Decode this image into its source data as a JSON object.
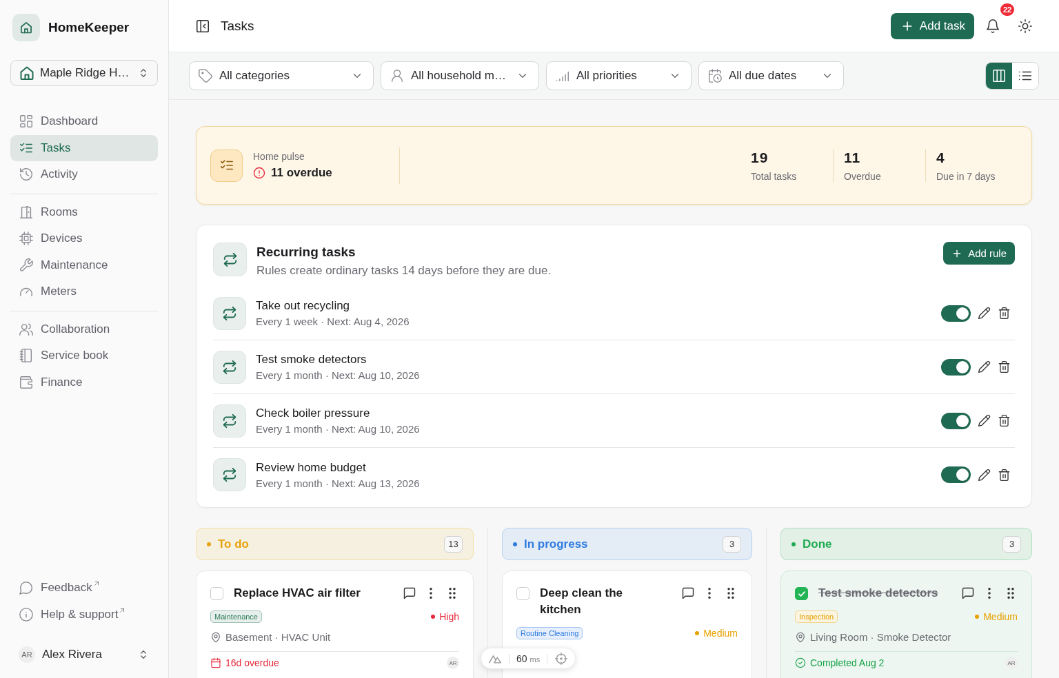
{
  "sidebar": {
    "brand": "HomeKeeper",
    "property": "Maple Ridge H…",
    "nav": [
      {
        "items": [
          {
            "label": "Dashboard",
            "selected": false
          },
          {
            "label": "Tasks",
            "selected": true
          },
          {
            "label": "Activity",
            "selected": false
          }
        ]
      },
      {
        "items": [
          {
            "label": "Rooms",
            "selected": false
          },
          {
            "label": "Devices",
            "selected": false
          },
          {
            "label": "Maintenance",
            "selected": false
          },
          {
            "label": "Meters",
            "selected": false
          }
        ]
      },
      {
        "items": [
          {
            "label": "Collaboration",
            "selected": false
          },
          {
            "label": "Service book",
            "selected": false
          },
          {
            "label": "Finance",
            "selected": false
          }
        ]
      }
    ],
    "links": [
      {
        "label": "Feedback"
      },
      {
        "label": "Help & support"
      }
    ],
    "user": {
      "initials": "AR",
      "name": "Alex Rivera"
    }
  },
  "header": {
    "title": "Tasks",
    "add_button": "Add task",
    "notification_count": "22"
  },
  "filters": [
    {
      "label": "All categories"
    },
    {
      "label": "All household m…"
    },
    {
      "label": "All priorities"
    },
    {
      "label": "All due dates"
    }
  ],
  "view_modes": [
    {
      "selected": true
    },
    {
      "selected": false
    }
  ],
  "pulse": {
    "label": "Home pulse",
    "alert": "11 overdue",
    "stats": [
      {
        "value": "19",
        "label": "Total tasks"
      },
      {
        "value": "11",
        "label": "Overdue"
      },
      {
        "value": "4",
        "label": "Due in 7 days"
      }
    ]
  },
  "recurring": {
    "title": "Recurring tasks",
    "subtitle": "Rules create ordinary tasks 14 days before they are due.",
    "add_button": "Add rule",
    "rules": [
      {
        "name": "Take out recycling",
        "schedule": "Every 1 week · Next: Aug 4, 2026",
        "on": true
      },
      {
        "name": "Test smoke detectors",
        "schedule": "Every 1 month · Next: Aug 10, 2026",
        "on": true
      },
      {
        "name": "Check boiler pressure",
        "schedule": "Every 1 month · Next: Aug 10, 2026",
        "on": true
      },
      {
        "name": "Review home budget",
        "schedule": "Every 1 month · Next: Aug 13, 2026",
        "on": true
      }
    ]
  },
  "board": {
    "columns": [
      {
        "title": "To do",
        "count": "13",
        "color": "#e6a30c",
        "cards": [
          {
            "title": "Replace HVAC air filter",
            "checked": false,
            "tag": {
              "label": "Maintenance",
              "color": "#2f7a5a"
            },
            "priority": {
              "label": "High",
              "color": "#e5283a"
            },
            "location": "Basement · HVAC Unit",
            "footer": {
              "kind": "overdue",
              "text": "16d overdue"
            },
            "assignee": "AR"
          }
        ]
      },
      {
        "title": "In progress",
        "count": "3",
        "color": "#2f7be0",
        "cards": [
          {
            "title": "Deep clean the kitchen",
            "checked": false,
            "tag": {
              "label": "Routine Cleaning",
              "color": "#2f7be0"
            },
            "priority": {
              "label": "Medium",
              "color": "#e8a200"
            }
          }
        ]
      },
      {
        "title": "Done",
        "count": "3",
        "color": "#1faa50",
        "cards": [
          {
            "title": "Test smoke detectors",
            "checked": true,
            "tag": {
              "label": "Inspection",
              "color": "#e0a100"
            },
            "priority": {
              "label": "Medium",
              "color": "#e8a200"
            },
            "location": "Living Room · Smoke Detector",
            "footer": {
              "kind": "completed",
              "text": "Completed Aug 2"
            },
            "assignee": "AR"
          }
        ]
      }
    ]
  },
  "devtools": {
    "time": "60",
    "unit": "ms"
  }
}
